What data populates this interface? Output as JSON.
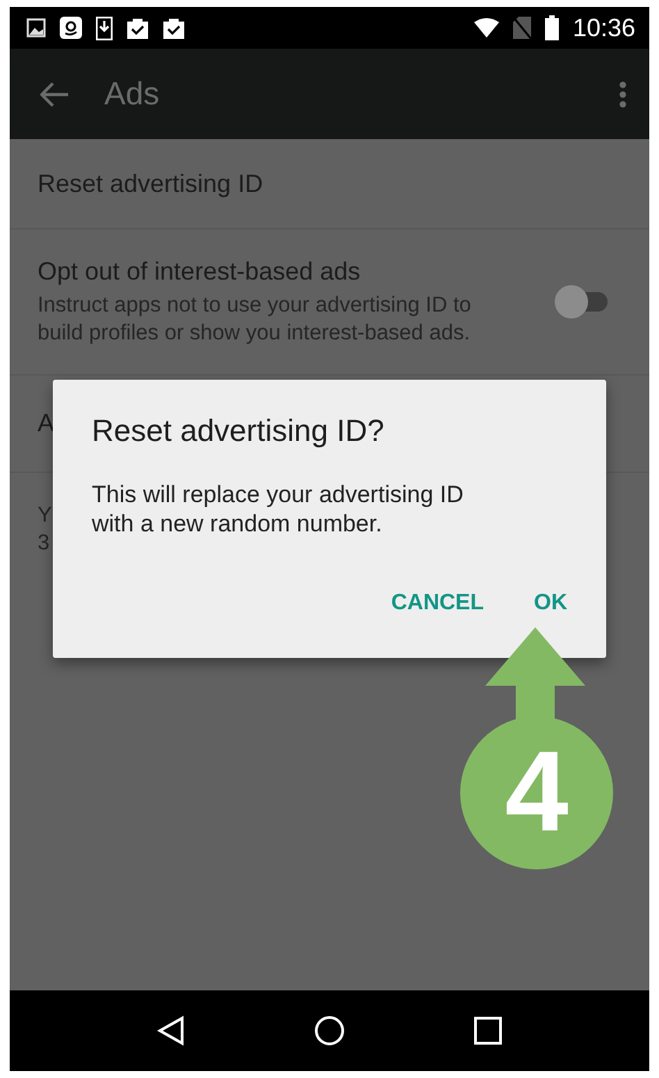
{
  "status_bar": {
    "time": "10:36"
  },
  "toolbar": {
    "title": "Ads"
  },
  "settings": [
    {
      "kind": "plain",
      "title": "Reset advertising ID"
    },
    {
      "kind": "switch",
      "title": "Opt out of interest-based ads",
      "summary": "Instruct apps not to use your advertising ID to build profiles or show you interest-based ads.",
      "on": false
    },
    {
      "kind": "plain",
      "title": "A"
    },
    {
      "kind": "lines",
      "lines": [
        "Y",
        "3"
      ]
    }
  ],
  "dialog": {
    "title": "Reset advertising ID?",
    "message": "This will replace your advertising ID with a new random number.",
    "buttons": [
      "CANCEL",
      "OK"
    ]
  },
  "step_badge": {
    "label": "4"
  }
}
